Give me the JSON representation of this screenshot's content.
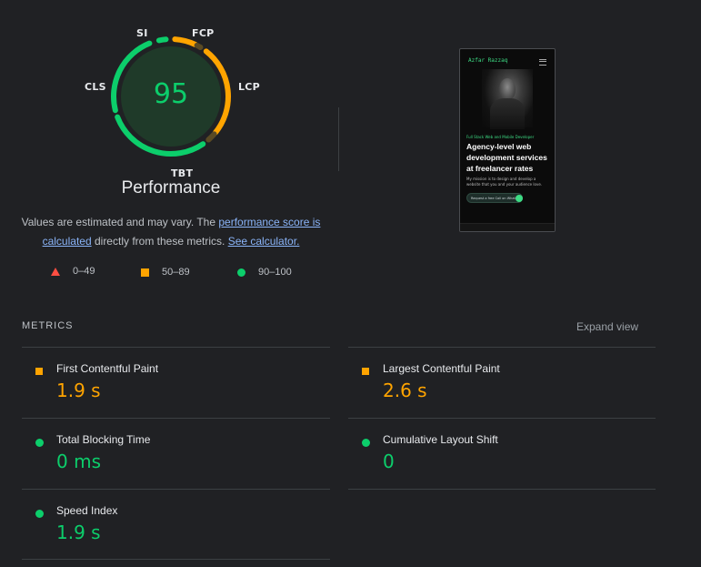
{
  "gauge": {
    "score": "95",
    "title": "Performance",
    "labels": {
      "si": "SI",
      "fcp": "FCP",
      "lcp": "LCP",
      "tbt": "TBT",
      "cls": "CLS"
    },
    "score_color": "#0cce6b"
  },
  "estimate": {
    "text_before": "Values are estimated and may vary. The ",
    "link_score": "performance score is calculated",
    "text_middle": " directly from these metrics. ",
    "link_calculator": "See calculator."
  },
  "legend": [
    {
      "shape": "triangle",
      "color": "#ff4e42",
      "range": "0–49"
    },
    {
      "shape": "square",
      "color": "#ffa400",
      "range": "50–89"
    },
    {
      "shape": "circle",
      "color": "#0cce6b",
      "range": "90–100"
    }
  ],
  "screenshot": {
    "brand": "Azfar Razzaq",
    "kicker": "Full Stack Web and Mobile Developer",
    "headline": "Agency-level web development services at freelancer rates",
    "body": "My mission is to design and develop a website that you and your audience love.",
    "button": "Request a free Call on WhatsApp"
  },
  "metrics": {
    "header": "METRICS",
    "expand": "Expand view",
    "items": [
      {
        "label": "First Contentful Paint",
        "value": "1.9 s",
        "status": "average"
      },
      {
        "label": "Largest Contentful Paint",
        "value": "2.6 s",
        "status": "average"
      },
      {
        "label": "Total Blocking Time",
        "value": "0 ms",
        "status": "pass"
      },
      {
        "label": "Cumulative Layout Shift",
        "value": "0",
        "status": "pass"
      },
      {
        "label": "Speed Index",
        "value": "1.9 s",
        "status": "pass"
      }
    ]
  },
  "colors": {
    "pass": "#0cce6b",
    "average": "#ffa400",
    "fail": "#ff4e42",
    "background": "#202124"
  }
}
